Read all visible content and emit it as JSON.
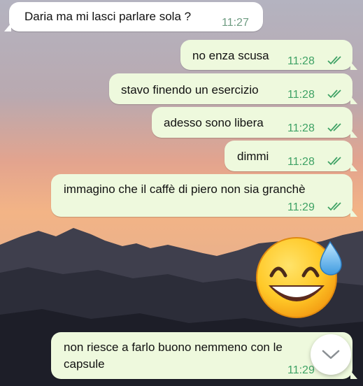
{
  "messages": [
    {
      "direction": "incoming",
      "text": "Daria ma mi lasci parlare sola ?",
      "time": "11:27"
    },
    {
      "direction": "outgoing",
      "text": "no enza scusa",
      "time": "11:28",
      "status": "read"
    },
    {
      "direction": "outgoing",
      "text": "stavo finendo un esercizio",
      "time": "11:28",
      "status": "read"
    },
    {
      "direction": "outgoing",
      "text": "adesso sono libera",
      "time": "11:28",
      "status": "read"
    },
    {
      "direction": "outgoing",
      "text": "dimmi",
      "time": "11:28",
      "status": "read"
    },
    {
      "direction": "outgoing",
      "text": "immagino che il caffè di piero non sia granchè",
      "time": "11:29",
      "status": "read"
    },
    {
      "direction": "outgoing",
      "sticker": "grinning-face-with-sweat-emoji"
    },
    {
      "direction": "outgoing",
      "text_line1": "non riesce a farlo buono nemmeno con le",
      "text_line2": "capsule",
      "time": "11:29"
    }
  ],
  "scroll_button_icon": "chevron-down-icon",
  "colors": {
    "incoming_bubble": "#ffffff",
    "outgoing_bubble": "#eef9dd",
    "timestamp": "#3fa265",
    "read_ticks": "#3fa265"
  }
}
